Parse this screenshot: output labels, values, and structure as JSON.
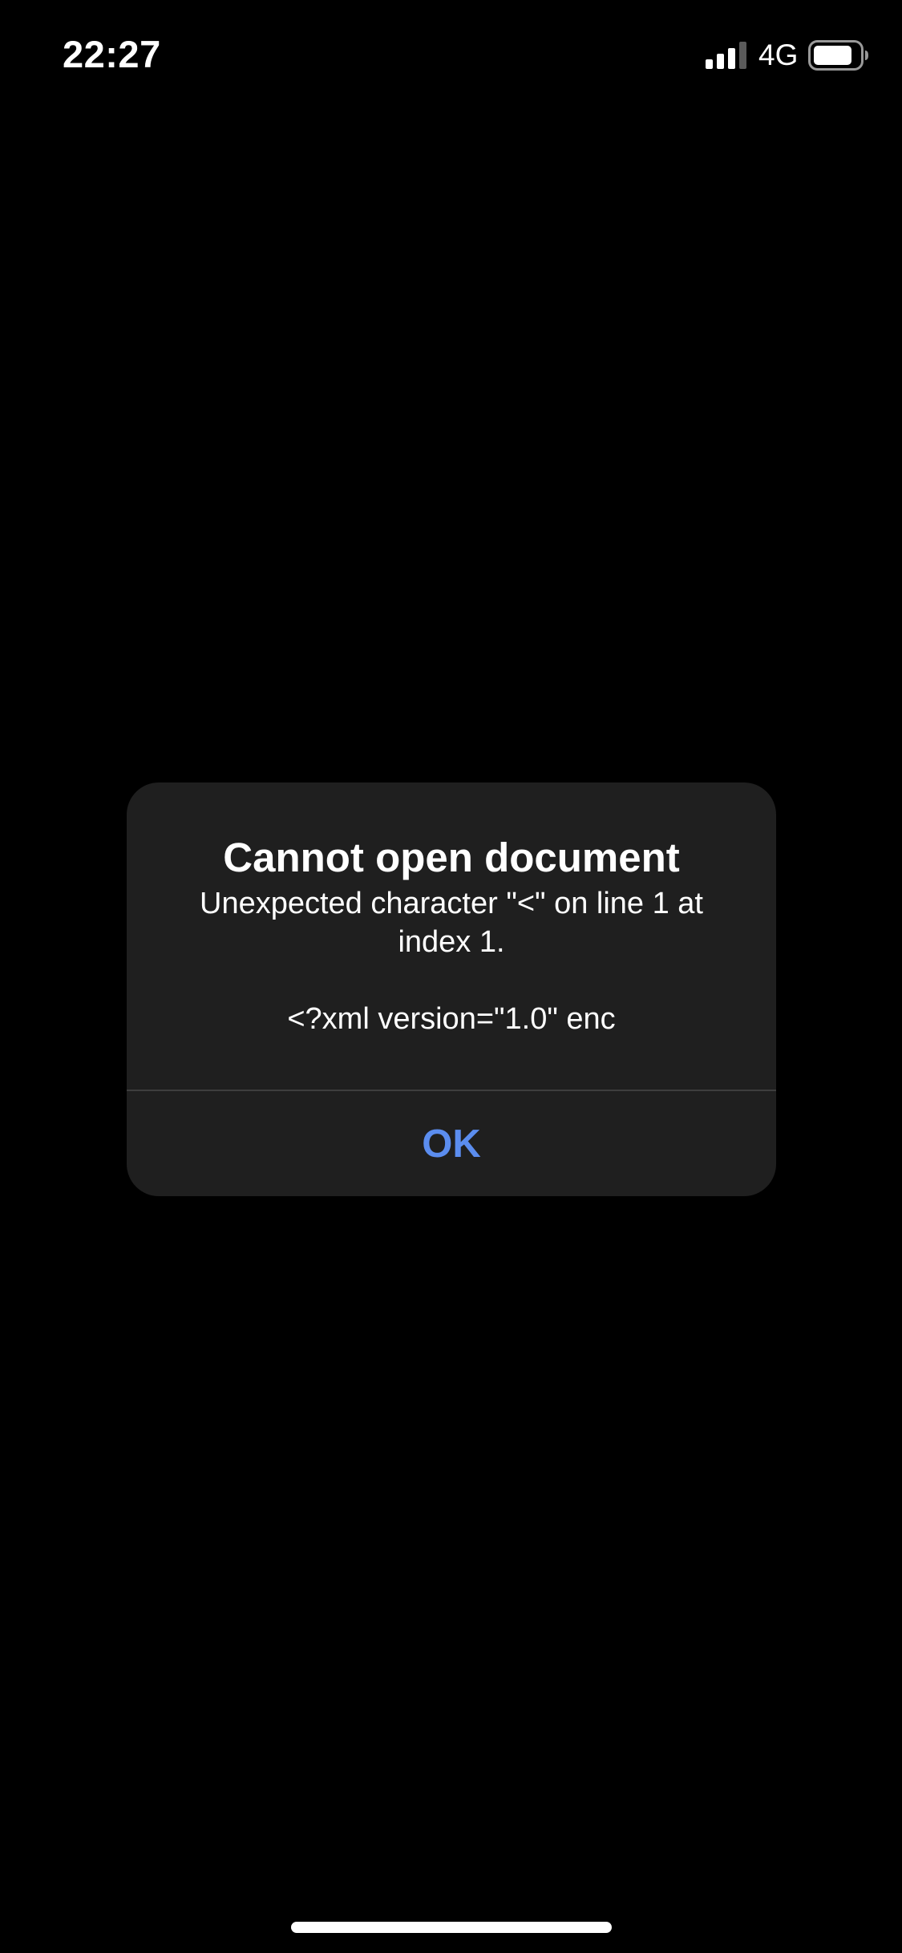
{
  "status_bar": {
    "time": "22:27",
    "network": "4G",
    "signal_icon": "cellular-signal-icon",
    "battery_icon": "battery-icon"
  },
  "alert": {
    "title": "Cannot open document",
    "message": "Unexpected character \"<\" on line 1 at\nindex 1.\n\n<?xml version=\"1.0\" enc",
    "ok_label": "OK"
  },
  "colors": {
    "background": "#000000",
    "dialog_background": "#1f1f1f",
    "accent": "#5b8def",
    "text": "#ffffff"
  }
}
